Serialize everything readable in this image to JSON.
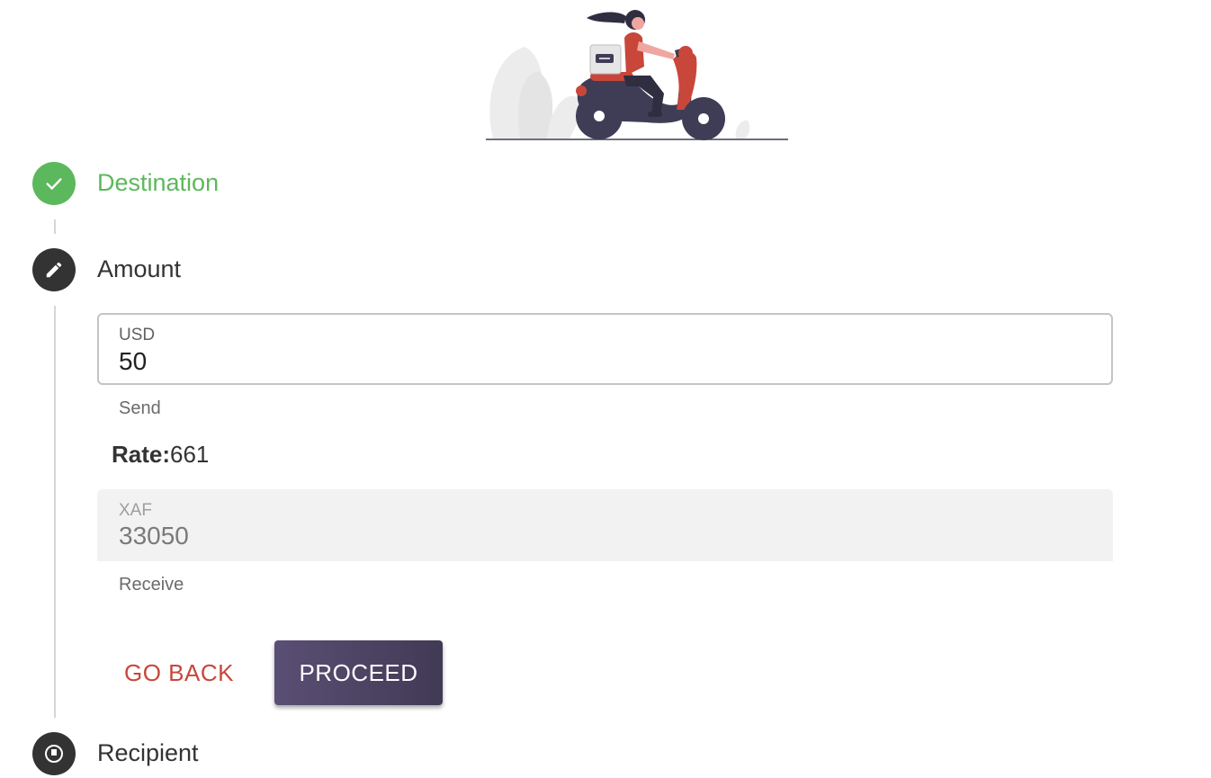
{
  "colors": {
    "done_green": "#5cb85c",
    "active_dark": "#333333",
    "back_red": "#c8473a",
    "proceed_purple": "#4e4566"
  },
  "illustration": {
    "name": "woman-on-scooter-illustration"
  },
  "steps": [
    {
      "label": "Destination",
      "status": "completed",
      "icon": "check-icon"
    },
    {
      "label": "Amount",
      "status": "active",
      "icon": "pencil-icon"
    },
    {
      "label": "Recipient",
      "status": "pending",
      "icon": "person-icon"
    }
  ],
  "amount": {
    "send_field": {
      "label": "USD",
      "value": "50",
      "helper": "Send"
    },
    "rate": {
      "label": "Rate:",
      "value": "661"
    },
    "receive_field": {
      "label": "XAF",
      "value": "33050",
      "helper": "Receive"
    },
    "buttons": {
      "back_label": "GO BACK",
      "proceed_label": "PROCEED"
    }
  }
}
